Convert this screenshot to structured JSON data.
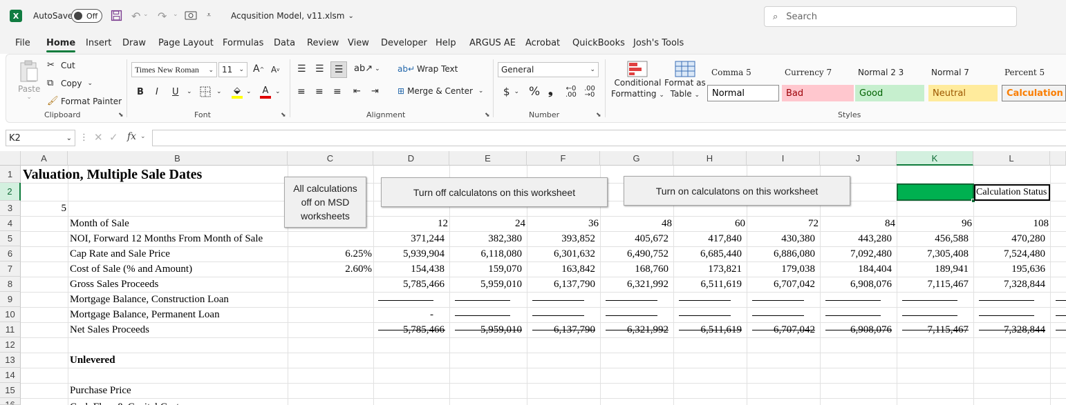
{
  "titlebar": {
    "autosave_label": "AutoSave",
    "autosave_state": "Off",
    "filename": "Acqusition Model, v11.xlsm",
    "search_placeholder": "Search"
  },
  "menu": [
    "File",
    "Home",
    "Insert",
    "Draw",
    "Page Layout",
    "Formulas",
    "Data",
    "Review",
    "View",
    "Developer",
    "Help",
    "ARGUS AE",
    "Acrobat",
    "QuickBooks",
    "Josh's Tools"
  ],
  "ribbon": {
    "clipboard": {
      "paste": "Paste",
      "cut": "Cut",
      "copy": "Copy",
      "format_painter": "Format Painter",
      "label": "Clipboard"
    },
    "font": {
      "name": "Times New Roman",
      "size": "11",
      "bold": "B",
      "italic": "I",
      "underline": "U",
      "label": "Font"
    },
    "alignment": {
      "wrap": "Wrap Text",
      "merge": "Merge & Center",
      "label": "Alignment"
    },
    "number": {
      "format": "General",
      "currency": "$",
      "percent": "%",
      "comma": "❟",
      "label": "Number"
    },
    "styles": {
      "conditional": [
        "Conditional",
        "Formatting"
      ],
      "format_table": [
        "Format as",
        "Table"
      ],
      "names": [
        "Comma 5",
        "Currency 7",
        "Normal 2 3",
        "Normal 7",
        "Percent 5"
      ],
      "boxes": [
        "Normal",
        "Bad",
        "Good",
        "Neutral",
        "Calculation"
      ],
      "label": "Styles"
    }
  },
  "formula_bar": {
    "name_box": "K2",
    "fx": "fx",
    "formula": ""
  },
  "columns": [
    "A",
    "B",
    "C",
    "D",
    "E",
    "F",
    "G",
    "H",
    "I",
    "J",
    "K",
    "L"
  ],
  "rows": [
    "1",
    "2",
    "3",
    "4",
    "5",
    "6",
    "7",
    "8",
    "9",
    "10",
    "11",
    "12",
    "13",
    "14",
    "15",
    "16"
  ],
  "sheet": {
    "title": "Valuation, Multiple Sale Dates",
    "a3": "5",
    "row_labels": {
      "r4": "Month of Sale",
      "r5": "NOI, Forward 12 Months From Month of Sale",
      "r6": "Cap Rate and Sale Price",
      "r7": "Cost of Sale (% and Amount)",
      "r8": "Gross Sales Proceeds",
      "r9": "Mortgage Balance, Construction Loan",
      "r10": "Mortgage Balance, Permanent Loan",
      "r11": "Net Sales Proceeds",
      "r13": "Unlevered",
      "r15": "Purchase Price"
    },
    "c6": "6.25%",
    "c7": "2.60%",
    "d10": "-",
    "calc_status_label": "Calculation Status",
    "month": [
      "12",
      "24",
      "36",
      "48",
      "60",
      "72",
      "84",
      "96",
      "108"
    ],
    "noi": [
      "371,244",
      "382,380",
      "393,852",
      "405,672",
      "417,840",
      "430,380",
      "443,280",
      "456,588",
      "470,280"
    ],
    "sale_price": [
      "5,939,904",
      "6,118,080",
      "6,301,632",
      "6,490,752",
      "6,685,440",
      "6,886,080",
      "7,092,480",
      "7,305,408",
      "7,524,480"
    ],
    "cost_of_sale": [
      "154,438",
      "159,070",
      "163,842",
      "168,760",
      "173,821",
      "179,038",
      "184,404",
      "189,941",
      "195,636"
    ],
    "gross": [
      "5,785,466",
      "5,959,010",
      "6,137,790",
      "6,321,992",
      "6,511,619",
      "6,707,042",
      "6,908,076",
      "7,115,467",
      "7,328,844"
    ],
    "net": [
      "5,785,466",
      "5,959,010",
      "6,137,790",
      "6,321,992",
      "6,511,619",
      "6,707,042",
      "6,908,076",
      "7,115,467",
      "7,328,844"
    ]
  },
  "buttons": {
    "msd": "All calculations off on MSD worksheets",
    "off": "Turn off calculatons on this worksheet",
    "on": "Turn on calculatons on this worksheet"
  },
  "colors": {
    "excel_green": "#107c41",
    "status_fill": "#00b050",
    "bad": "#ffc7ce",
    "good": "#c6efce",
    "neutral": "#ffeb9c"
  }
}
